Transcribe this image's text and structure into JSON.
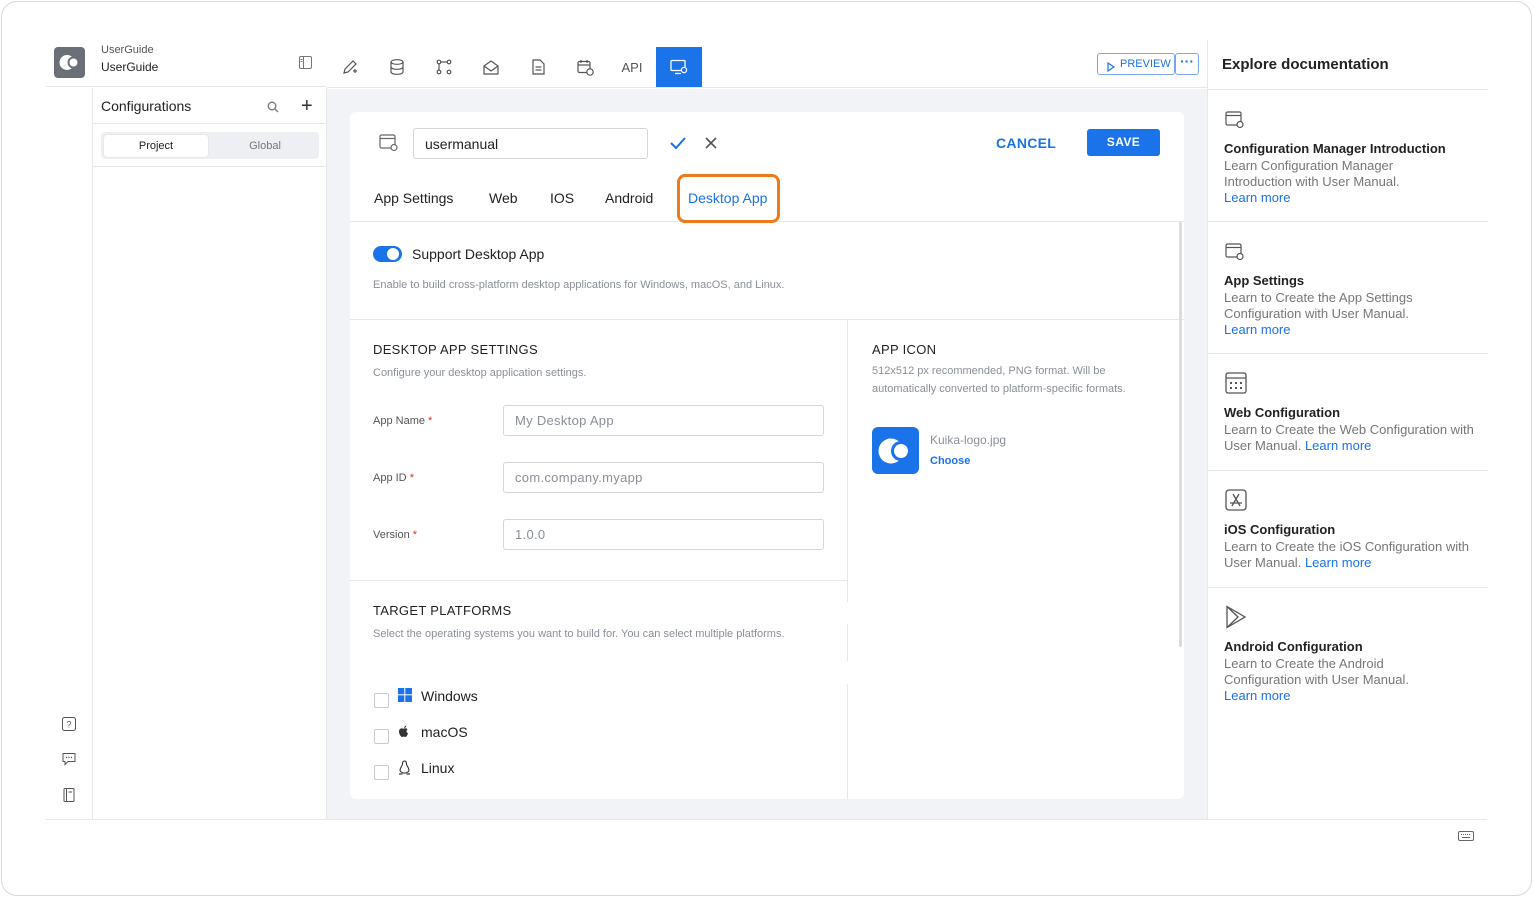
{
  "brand": {
    "line1": "UserGuide",
    "line2": "UserGuide"
  },
  "config_panel": {
    "title": "Configurations",
    "segments": [
      "Project",
      "Global"
    ]
  },
  "toolbar": {
    "api_label": "API",
    "preview_label": "PREVIEW",
    "more_label": "···"
  },
  "editor": {
    "name_value": "usermanual",
    "cancel_label": "CANCEL",
    "save_label": "SAVE",
    "tabs": [
      "App Settings",
      "Web",
      "IOS",
      "Android",
      "Desktop App"
    ],
    "active_tab": "Desktop App",
    "support_toggle": {
      "label": "Support Desktop App",
      "on": true,
      "description": "Enable to build cross-platform desktop applications for Windows, macOS, and Linux."
    },
    "desktop_settings": {
      "title": "DESKTOP APP SETTINGS",
      "description": "Configure your desktop application settings.",
      "fields": [
        {
          "label": "App Name",
          "required": "*",
          "placeholder": "My Desktop App"
        },
        {
          "label": "App ID",
          "required": "*",
          "placeholder": "com.company.myapp"
        },
        {
          "label": "Version",
          "required": "*",
          "placeholder": "1.0.0"
        }
      ]
    },
    "app_icon": {
      "title": "APP ICON",
      "description": "512x512 px recommended, PNG format. Will be automatically converted to platform-specific formats.",
      "file_name": "Kuika-logo.jpg",
      "choose_label": "Choose"
    },
    "target_platforms": {
      "title": "TARGET PLATFORMS",
      "description": "Select the operating systems you want to build for. You can select multiple platforms.",
      "platforms": [
        {
          "label": "Windows",
          "icon": "windows-icon",
          "checked": false
        },
        {
          "label": "macOS",
          "icon": "apple-icon",
          "checked": false
        },
        {
          "label": "Linux",
          "icon": "linux-icon",
          "checked": false
        }
      ]
    }
  },
  "docs": {
    "title": "Explore documentation",
    "learn_more": "Learn more",
    "items": [
      {
        "icon": "config-window-icon",
        "title": "Configuration Manager Introduction",
        "desc": "Learn Configuration Manager Introduction with User Manual."
      },
      {
        "icon": "config-window-icon",
        "title": "App Settings",
        "desc": "Learn to Create the App Settings Configuration with User Manual."
      },
      {
        "icon": "web-calendar-icon",
        "title": "Web Configuration",
        "desc": "Learn to Create the Web Configuration with User Manual."
      },
      {
        "icon": "app-store-icon",
        "title": "iOS Configuration",
        "desc": "Learn to Create the iOS Configuration with User Manual."
      },
      {
        "icon": "play-store-icon",
        "title": "Android Configuration",
        "desc": "Learn to Create the Android Configuration with User Manual."
      }
    ]
  },
  "colors": {
    "accent": "#1a73e8",
    "highlight": "#f07a1a",
    "required": "#d93025"
  }
}
